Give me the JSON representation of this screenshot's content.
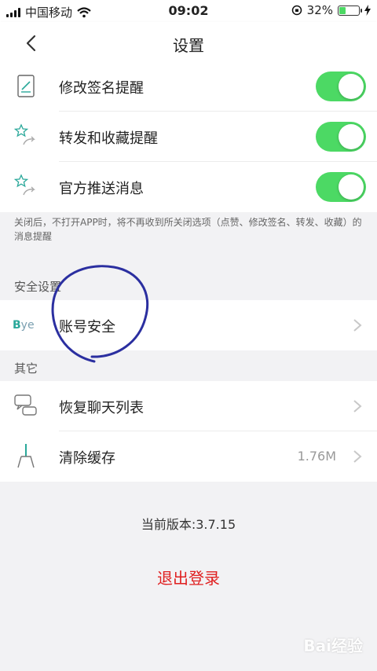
{
  "status_bar": {
    "carrier": "中国移动",
    "time": "09:02",
    "battery_percent": "32%",
    "battery_level": 0.32,
    "battery_color": "#4cd964"
  },
  "nav": {
    "title": "设置",
    "back_icon": "chevron-left-icon"
  },
  "notifications": {
    "items": [
      {
        "label": "修改签名提醒",
        "icon": "signature-icon",
        "enabled": true
      },
      {
        "label": "转发和收藏提醒",
        "icon": "star-share-icon",
        "enabled": true
      },
      {
        "label": "官方推送消息",
        "icon": "star-share-icon",
        "enabled": true
      }
    ],
    "note": "关闭后，不打开APP时，将不再收到所关闭选项（点赞、修改签名、转发、收藏）的消息提醒",
    "toggle_color": "#4cd964"
  },
  "security": {
    "section_title": "安全设置",
    "items": [
      {
        "label": "账号安全",
        "icon": "bye-logo-icon",
        "logo_text": "Bye"
      }
    ]
  },
  "other": {
    "section_title": "其它",
    "items": [
      {
        "label": "恢复聊天列表",
        "icon": "chat-bubbles-icon",
        "value": ""
      },
      {
        "label": "清除缓存",
        "icon": "broom-icon",
        "value": "1.76M"
      }
    ]
  },
  "footer": {
    "version": "当前版本:3.7.15",
    "logout": "退出登录",
    "logout_color": "#e02020"
  },
  "watermark": {
    "text": "Bai经验"
  }
}
